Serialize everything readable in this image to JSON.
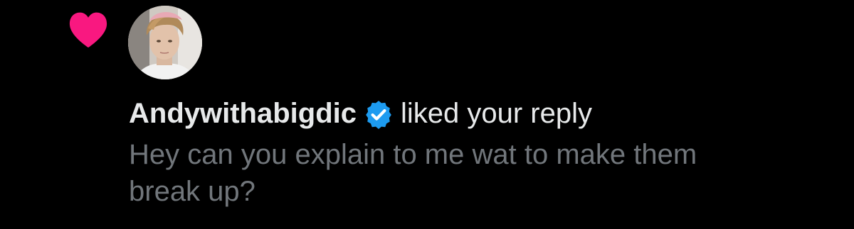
{
  "notification": {
    "type_icon": "heart-icon",
    "type_icon_color": "#f91880",
    "avatar_icon": "user-avatar",
    "username": "Andywithabigdic",
    "verified_icon": "verified-badge-icon",
    "verified_color": "#1d9bf0",
    "action_text": "liked your reply",
    "reply_text": "Hey can you explain to me wat to make them break up?"
  },
  "colors": {
    "background": "#000000",
    "primary_text": "#e7e9ea",
    "secondary_text": "#71767b"
  }
}
